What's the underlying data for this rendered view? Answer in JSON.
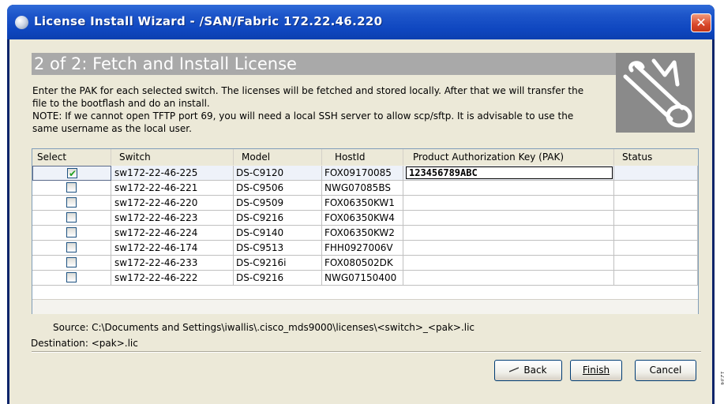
{
  "window": {
    "title": "License Install Wizard - /SAN/Fabric 172.22.46.220",
    "close_label": "✕"
  },
  "header": {
    "step_title": "2 of 2: Fetch and Install License"
  },
  "description": {
    "line1": "Enter the PAK for each selected switch.  The licenses will be fetched and stored locally. After that we will transfer the",
    "line2": "file to the bootflash and do an install.",
    "line3": "NOTE: If we cannot open TFTP port 69, you will need a local SSH server to allow scp/sftp. It is advisable to use the",
    "line4": "same username as the local user."
  },
  "table": {
    "columns": [
      "Select",
      "Switch",
      "Model",
      "HostId",
      "Product Authorization Key (PAK)",
      "Status"
    ],
    "rows": [
      {
        "selected": true,
        "switch": "sw172-22-46-225",
        "model": "DS-C9120",
        "hostid": "FOX09170085",
        "pak": "123456789ABC",
        "status": ""
      },
      {
        "selected": false,
        "switch": "sw172-22-46-221",
        "model": "DS-C9506",
        "hostid": "NWG07085BS",
        "pak": "",
        "status": ""
      },
      {
        "selected": false,
        "switch": "sw172-22-46-220",
        "model": "DS-C9509",
        "hostid": "FOX06350KW1",
        "pak": "",
        "status": ""
      },
      {
        "selected": false,
        "switch": "sw172-22-46-223",
        "model": "DS-C9216",
        "hostid": "FOX06350KW4",
        "pak": "",
        "status": ""
      },
      {
        "selected": false,
        "switch": "sw172-22-46-224",
        "model": "DS-C9140",
        "hostid": "FOX06350KW2",
        "pak": "",
        "status": ""
      },
      {
        "selected": false,
        "switch": "sw172-22-46-174",
        "model": "DS-C9513",
        "hostid": "FHH0927006V",
        "pak": "",
        "status": ""
      },
      {
        "selected": false,
        "switch": "sw172-22-46-233",
        "model": "DS-C9216i",
        "hostid": "FOX080502DK",
        "pak": "",
        "status": ""
      },
      {
        "selected": false,
        "switch": "sw172-22-46-222",
        "model": "DS-C9216",
        "hostid": "NWG07150400",
        "pak": "",
        "status": ""
      }
    ]
  },
  "info": {
    "source_label": "Source:",
    "source_value": "C:\\Documents and Settings\\iwallis\\.cisco_mds9000\\licenses\\<switch>_<pak>.lic",
    "destination_label": "Destination:",
    "destination_value": "<pak>.lic"
  },
  "buttons": {
    "back_label": "Back",
    "finish_label": "Finish",
    "cancel_label": "Cancel"
  },
  "side_id": "1234"
}
